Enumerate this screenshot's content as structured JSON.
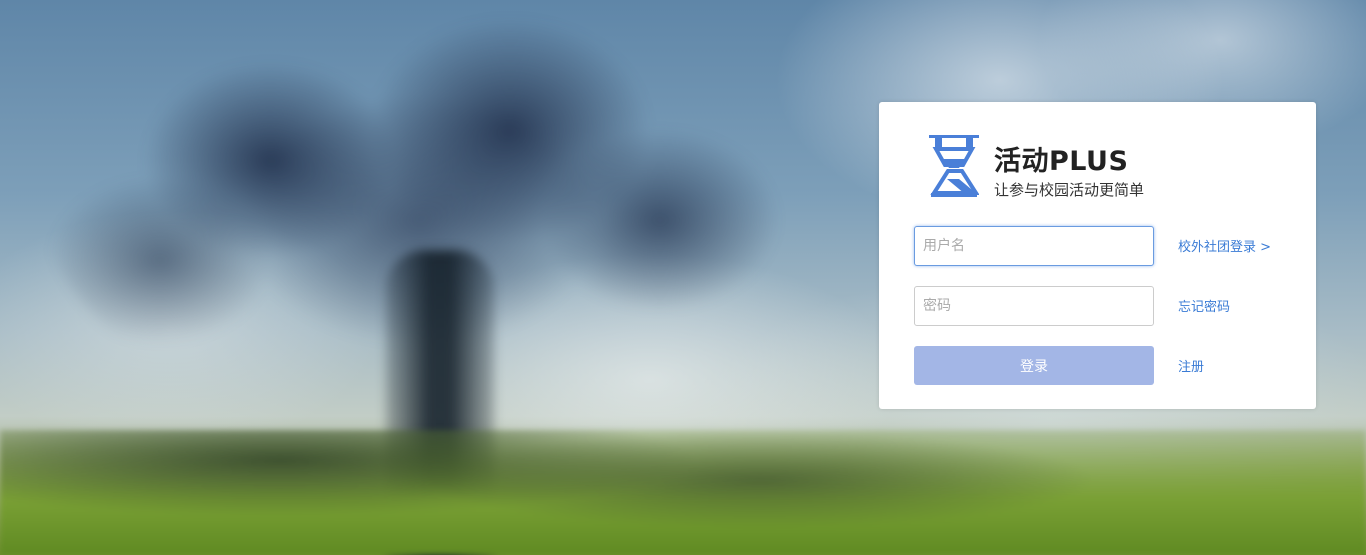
{
  "brand": {
    "title": "活动PLUS",
    "slogan": "让参与校园活动更简单",
    "logo_icon": "hourglass-logo-icon",
    "logo_color": "#4a7fd8"
  },
  "form": {
    "username_placeholder": "用户名",
    "username_value": "",
    "password_placeholder": "密码",
    "password_value": "",
    "login_label": "登录"
  },
  "links": {
    "outside_club_login": "校外社团登录 >",
    "forgot_password": "忘记密码",
    "register": "注册"
  },
  "colors": {
    "accent_link": "#3a7bd5",
    "login_button": "#a3b6e6",
    "focused_border": "#6a9be0"
  }
}
